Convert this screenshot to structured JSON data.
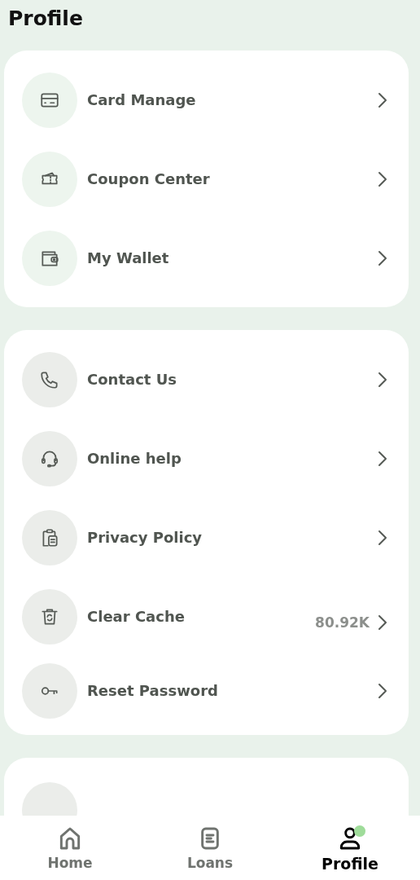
{
  "title": "Profile",
  "sections": [
    {
      "items": [
        {
          "label": "Card Manage"
        },
        {
          "label": "Coupon Center"
        },
        {
          "label": "My Wallet"
        }
      ]
    },
    {
      "items": [
        {
          "label": "Contact Us"
        },
        {
          "label": "Online help"
        },
        {
          "label": "Privacy Policy"
        },
        {
          "label": "Clear Cache",
          "value": "80.92K"
        },
        {
          "label": "Reset Password"
        }
      ]
    }
  ],
  "nav": [
    {
      "label": "Home",
      "selected": false
    },
    {
      "label": "Loans",
      "selected": false
    },
    {
      "label": "Profile",
      "selected": true
    }
  ]
}
